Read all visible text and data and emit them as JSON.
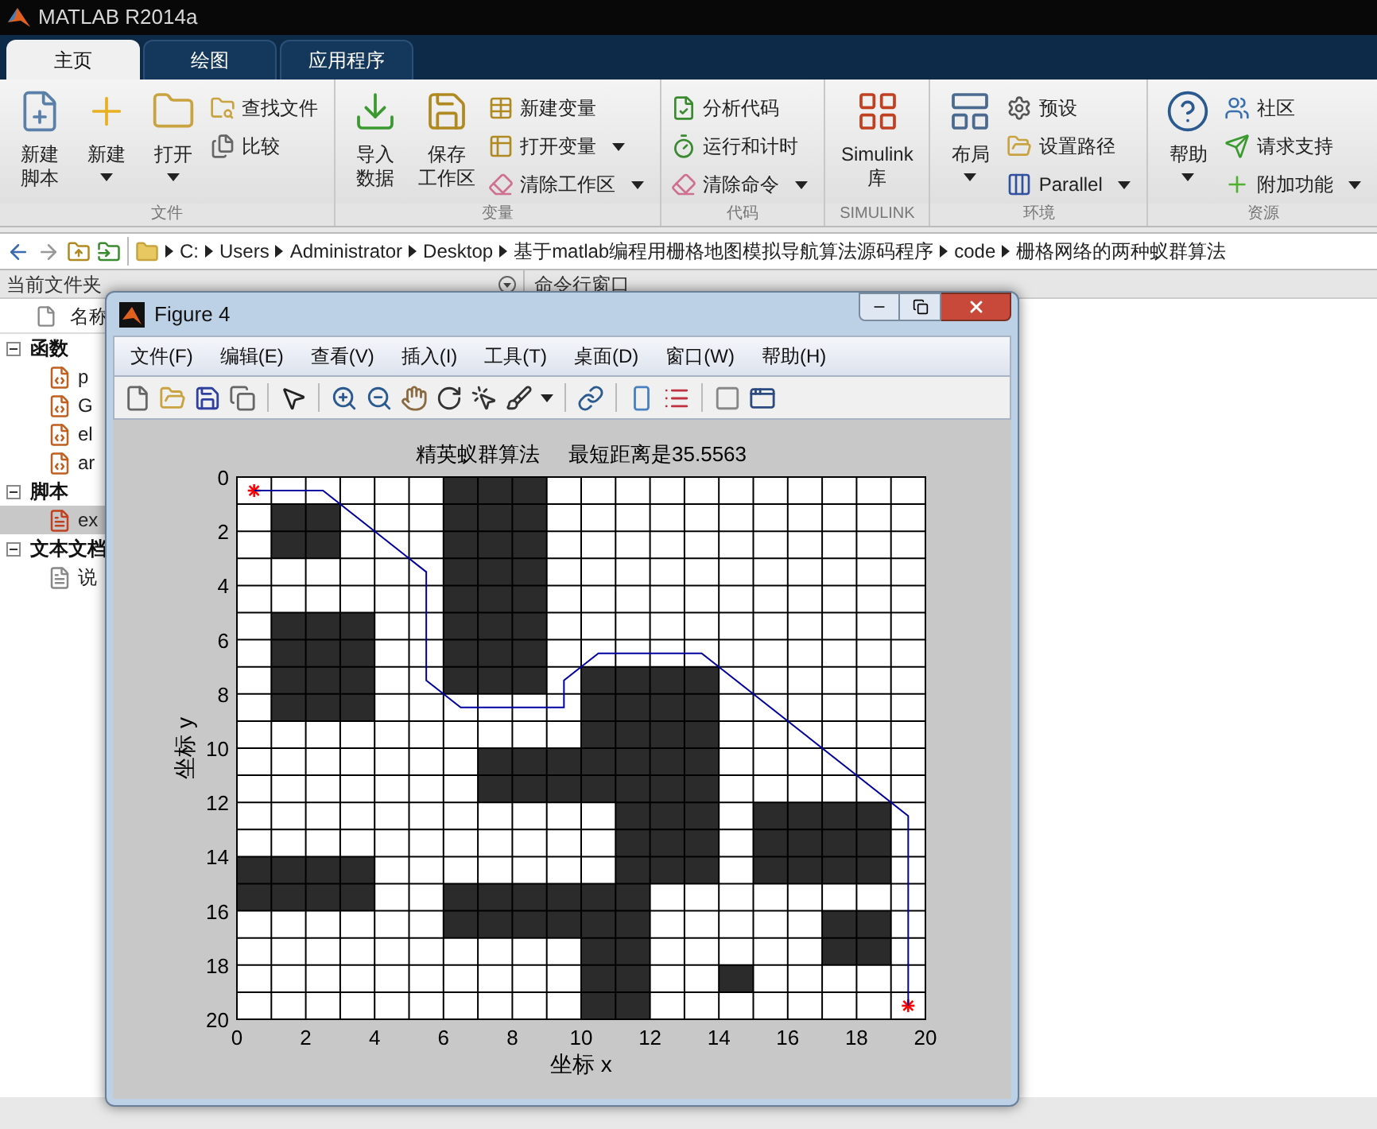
{
  "app_title": "MATLAB R2014a",
  "ribbon_tabs": [
    {
      "label": "主页",
      "selected": true
    },
    {
      "label": "绘图",
      "selected": false
    },
    {
      "label": "应用程序",
      "selected": false
    }
  ],
  "ribbon_groups": [
    {
      "label": "文件",
      "controls": [
        {
          "kind": "large",
          "label_lines": [
            "新建",
            "脚本"
          ],
          "dropdown": false
        },
        {
          "kind": "large",
          "label_lines": [
            "新建"
          ],
          "dropdown": true
        },
        {
          "kind": "large",
          "label_lines": [
            "打开"
          ],
          "dropdown": true
        },
        {
          "kind": "small",
          "label": "查找文件",
          "dropdown": false
        },
        {
          "kind": "small",
          "label": "比较",
          "dropdown": false
        }
      ]
    },
    {
      "label": "变量",
      "controls": [
        {
          "kind": "large",
          "label_lines": [
            "导入",
            "数据"
          ],
          "dropdown": false
        },
        {
          "kind": "large",
          "label_lines": [
            "保存",
            "工作区"
          ],
          "dropdown": false
        },
        {
          "kind": "small",
          "label": "新建变量",
          "dropdown": false
        },
        {
          "kind": "small",
          "label": "打开变量",
          "dropdown": true
        },
        {
          "kind": "small",
          "label": "清除工作区",
          "dropdown": true
        }
      ]
    },
    {
      "label": "代码",
      "controls": [
        {
          "kind": "small",
          "label": "分析代码",
          "dropdown": false
        },
        {
          "kind": "small",
          "label": "运行和计时",
          "dropdown": false
        },
        {
          "kind": "small",
          "label": "清除命令",
          "dropdown": true
        }
      ]
    },
    {
      "label": "SIMULINK",
      "controls": [
        {
          "kind": "large",
          "label_lines": [
            "Simulink",
            "库"
          ],
          "dropdown": false
        }
      ]
    },
    {
      "label": "环境",
      "controls": [
        {
          "kind": "large",
          "label_lines": [
            "布局"
          ],
          "dropdown": true
        },
        {
          "kind": "small",
          "label": "预设",
          "dropdown": false
        },
        {
          "kind": "small",
          "label": "设置路径",
          "dropdown": false
        },
        {
          "kind": "small",
          "label": "Parallel",
          "dropdown": true
        }
      ]
    },
    {
      "label": "资源",
      "controls": [
        {
          "kind": "large",
          "label_lines": [
            "帮助"
          ],
          "dropdown": true
        },
        {
          "kind": "small",
          "label": "社区",
          "dropdown": false
        },
        {
          "kind": "small",
          "label": "请求支持",
          "dropdown": false
        },
        {
          "kind": "small",
          "label": "附加功能",
          "dropdown": true
        }
      ]
    }
  ],
  "path_bar": {
    "crumbs": [
      "C:",
      "Users",
      "Administrator",
      "Desktop",
      "基于matlab编程用栅格地图模拟导航算法源码程序",
      "code",
      "栅格网络的两种蚁群算法"
    ]
  },
  "file_browser": {
    "title": "当前文件夹",
    "column_header": "名称",
    "groups": [
      {
        "label": "函数",
        "expanded": true,
        "children": [
          {
            "label": "p",
            "kind": "function",
            "selected": false
          },
          {
            "label": "G",
            "kind": "function",
            "selected": false
          },
          {
            "label": "el",
            "kind": "function",
            "selected": false
          },
          {
            "label": "ar",
            "kind": "function",
            "selected": false
          }
        ]
      },
      {
        "label": "脚本",
        "expanded": true,
        "children": [
          {
            "label": "ex",
            "kind": "script",
            "selected": true
          }
        ]
      },
      {
        "label": "文本文档",
        "expanded": true,
        "children": [
          {
            "label": "说",
            "kind": "text",
            "selected": false
          }
        ]
      }
    ]
  },
  "command_window": {
    "title": "命令行窗口"
  },
  "figure": {
    "title": "Figure 4",
    "menu": [
      "文件(F)",
      "编辑(E)",
      "查看(V)",
      "插入(I)",
      "工具(T)",
      "桌面(D)",
      "窗口(W)",
      "帮助(H)"
    ],
    "plot": {
      "obstacle_grid": [
        [
          false,
          false,
          false,
          false,
          false,
          false,
          true,
          true,
          true,
          false,
          false,
          false,
          false,
          false,
          false,
          false,
          false,
          false,
          false,
          false
        ],
        [
          false,
          true,
          true,
          false,
          false,
          false,
          true,
          true,
          true,
          false,
          false,
          false,
          false,
          false,
          false,
          false,
          false,
          false,
          false,
          false
        ],
        [
          false,
          true,
          true,
          false,
          false,
          false,
          true,
          true,
          true,
          false,
          false,
          false,
          false,
          false,
          false,
          false,
          false,
          false,
          false,
          false
        ],
        [
          false,
          false,
          false,
          false,
          false,
          false,
          true,
          true,
          true,
          false,
          false,
          false,
          false,
          false,
          false,
          false,
          false,
          false,
          false,
          false
        ],
        [
          false,
          false,
          false,
          false,
          false,
          false,
          true,
          true,
          true,
          false,
          false,
          false,
          false,
          false,
          false,
          false,
          false,
          false,
          false,
          false
        ],
        [
          false,
          true,
          true,
          true,
          false,
          false,
          true,
          true,
          true,
          false,
          false,
          false,
          false,
          false,
          false,
          false,
          false,
          false,
          false,
          false
        ],
        [
          false,
          true,
          true,
          true,
          false,
          false,
          true,
          true,
          true,
          false,
          false,
          false,
          false,
          false,
          false,
          false,
          false,
          false,
          false,
          false
        ],
        [
          false,
          true,
          true,
          true,
          false,
          false,
          true,
          true,
          true,
          false,
          true,
          true,
          true,
          true,
          false,
          false,
          false,
          false,
          false,
          false
        ],
        [
          false,
          true,
          true,
          true,
          false,
          false,
          false,
          false,
          false,
          false,
          true,
          true,
          true,
          true,
          false,
          false,
          false,
          false,
          false,
          false
        ],
        [
          false,
          false,
          false,
          false,
          false,
          false,
          false,
          false,
          false,
          false,
          true,
          true,
          true,
          true,
          false,
          false,
          false,
          false,
          false,
          false
        ],
        [
          false,
          false,
          false,
          false,
          false,
          false,
          false,
          true,
          true,
          true,
          true,
          true,
          true,
          true,
          false,
          false,
          false,
          false,
          false,
          false
        ],
        [
          false,
          false,
          false,
          false,
          false,
          false,
          false,
          true,
          true,
          true,
          true,
          true,
          true,
          true,
          false,
          false,
          false,
          false,
          false,
          false
        ],
        [
          false,
          false,
          false,
          false,
          false,
          false,
          false,
          false,
          false,
          false,
          false,
          true,
          true,
          true,
          false,
          true,
          true,
          true,
          true,
          false
        ],
        [
          false,
          false,
          false,
          false,
          false,
          false,
          false,
          false,
          false,
          false,
          false,
          true,
          true,
          true,
          false,
          true,
          true,
          true,
          true,
          false
        ],
        [
          true,
          true,
          true,
          true,
          false,
          false,
          false,
          false,
          false,
          false,
          false,
          true,
          true,
          true,
          false,
          true,
          true,
          true,
          true,
          false
        ],
        [
          true,
          true,
          true,
          true,
          false,
          false,
          true,
          true,
          true,
          true,
          true,
          true,
          false,
          false,
          false,
          false,
          false,
          false,
          false,
          false
        ],
        [
          false,
          false,
          false,
          false,
          false,
          false,
          true,
          true,
          true,
          true,
          true,
          true,
          false,
          false,
          false,
          false,
          false,
          true,
          true,
          false
        ],
        [
          false,
          false,
          false,
          false,
          false,
          false,
          false,
          false,
          false,
          false,
          true,
          true,
          false,
          false,
          false,
          false,
          false,
          true,
          true,
          false
        ],
        [
          false,
          false,
          false,
          false,
          false,
          false,
          false,
          false,
          false,
          false,
          true,
          true,
          false,
          false,
          true,
          false,
          false,
          false,
          false,
          false
        ],
        [
          false,
          false,
          false,
          false,
          false,
          false,
          false,
          false,
          false,
          false,
          true,
          true,
          false,
          false,
          false,
          false,
          false,
          false,
          false,
          false
        ]
      ],
      "chart_data": {
        "type": "line",
        "title": "精英蚁群算法     最短距离是35.5563",
        "xlabel": "坐标 x",
        "ylabel": "坐标 y",
        "x": [
          0.5,
          2.5,
          5.5,
          5.5,
          6.5,
          9.5,
          9.5,
          10.5,
          13.5,
          19.5,
          19.5
        ],
        "series": [
          {
            "color": "#0000a0",
            "marker": "cross",
            "values": [
              0.5,
              0.5,
              3.5,
              7.5,
              8.5,
              8.5,
              7.5,
              6.5,
              6.5,
              12.5,
              19.5
            ]
          }
        ],
        "grid": true,
        "xlim": [
          0,
          20
        ],
        "ylim": [
          20,
          0
        ],
        "xticks": [
          0,
          2,
          4,
          6,
          8,
          10,
          12,
          14,
          16,
          18,
          20
        ],
        "yticks": [
          0,
          2,
          4,
          6,
          8,
          10,
          12,
          14,
          16,
          18,
          20
        ]
      }
    }
  }
}
